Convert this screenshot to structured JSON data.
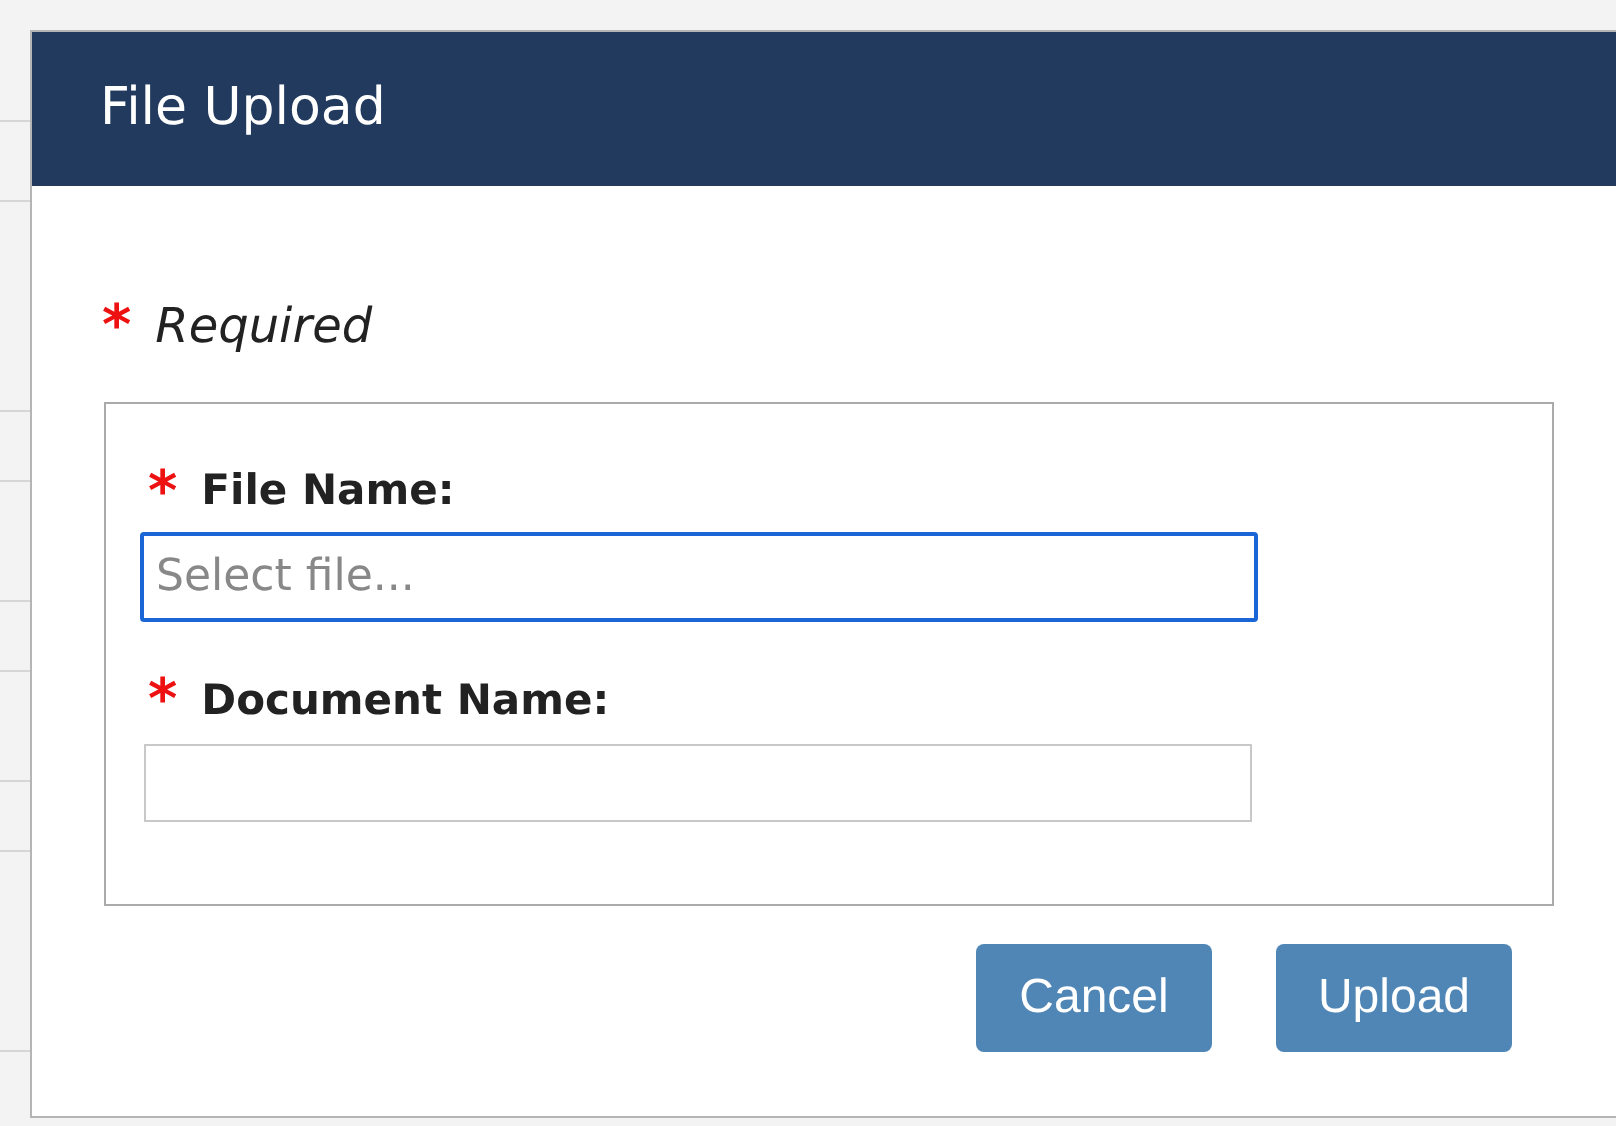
{
  "dialog": {
    "title": "File Upload",
    "legend": {
      "marker": "*",
      "text": "Required"
    },
    "fields": [
      {
        "marker": "*",
        "label": "File Name:",
        "placeholder": "Select file...",
        "focused": true
      },
      {
        "marker": "*",
        "label": "Document Name:",
        "focused": false
      }
    ],
    "buttons": [
      "Cancel",
      "Upload"
    ]
  }
}
